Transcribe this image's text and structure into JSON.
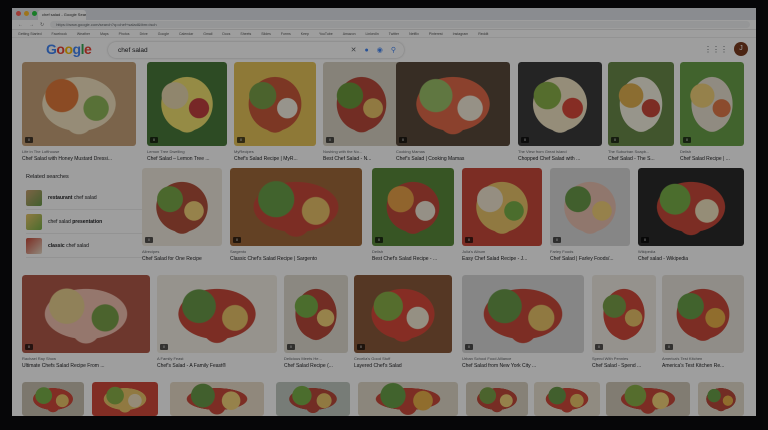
{
  "browser": {
    "tab_title": "chef salad - Google Search",
    "url": "https://www.google.com/search?q=chef+salad&tbm=isch",
    "bookmarks": [
      "Getting Started",
      "Facebook",
      "Weather",
      "Maps",
      "Photos",
      "Drive",
      "Google",
      "Calendar",
      "Gmail",
      "Docs",
      "Sheets",
      "Slides",
      "Forms",
      "Keep",
      "YouTube",
      "Amazon",
      "LinkedIn",
      "Twitter",
      "Netflix",
      "Pinterest",
      "Instagram",
      "Reddit"
    ]
  },
  "google": {
    "logo": "Google",
    "query": "chef salad",
    "avatar": "J"
  },
  "related": {
    "title": "Related searches",
    "items": [
      {
        "bold": "restaurant",
        "rest": " chef salad"
      },
      {
        "bold": "",
        "rest": "chef salad ",
        "bold2": "presentation"
      },
      {
        "bold": "classic",
        "rest": " chef salad"
      }
    ]
  },
  "results": [
    {
      "source": "Life in The Lofthouse",
      "title": "Chef Salad with Honey Mustard Dressi...",
      "colors": [
        "#c7a27a",
        "#e07a3a",
        "#8fb65a",
        "#f2e3c1"
      ]
    },
    {
      "source": "Lemon Tree Dwelling",
      "title": "Chef Salad – Lemon Tree ...",
      "colors": [
        "#4a7a3a",
        "#e8d8b0",
        "#c04040",
        "#f0e070"
      ]
    },
    {
      "source": "MyRecipes",
      "title": "Chef's Salad Recipe | MyR...",
      "colors": [
        "#e6c45a",
        "#7aa04a",
        "#f4efe2",
        "#c85a3a"
      ]
    },
    {
      "source": "Noshing with the No...",
      "title": "Best Chef Salad - N...",
      "colors": [
        "#d8d2c4",
        "#6b9a3c",
        "#e9c36a",
        "#b84a3a"
      ]
    },
    {
      "source": "Cooking Mamas",
      "title": "Chef's Salad | Cooking Mamas",
      "colors": [
        "#5a4a3a",
        "#9bc06a",
        "#f2ead8",
        "#e06a4a"
      ]
    },
    {
      "source": "The View from Great Island",
      "title": "Chopped Chef Salad with ...",
      "colors": [
        "#3a3a3a",
        "#8ab04a",
        "#d84a3a",
        "#f0e4c4"
      ]
    },
    {
      "source": "The Suburban Soapb...",
      "title": "Chef Salad - The S...",
      "colors": [
        "#6a8a4a",
        "#e0b050",
        "#c84a3a",
        "#f4f0e0"
      ]
    },
    {
      "source": "Delish",
      "title": "Chef Salad Recipe | ...",
      "colors": [
        "#6aa04a",
        "#f0d07a",
        "#e07a4a",
        "#e8e0d0"
      ]
    },
    {
      "source": "Allrecipes",
      "title": "Chef Salad for One Recipe",
      "colors": [
        "#efe9de",
        "#7aa84a",
        "#f2d27a",
        "#b0503a"
      ]
    },
    {
      "source": "Sargento",
      "title": "Classic Chef's Salad Recipe | Sargento",
      "colors": [
        "#a06a3a",
        "#6aa04a",
        "#e8c26a",
        "#c84a3a"
      ]
    },
    {
      "source": "Delish",
      "title": "Best Chef's Salad Recipe - ...",
      "colors": [
        "#5a8a3a",
        "#e8a24a",
        "#f0e8d8",
        "#c04a3a"
      ]
    },
    {
      "source": "Julia's Album",
      "title": "Easy Chef Salad Recipe - J...",
      "colors": [
        "#c84a3a",
        "#f0e6d0",
        "#7ab04a",
        "#e8c46a"
      ]
    },
    {
      "source": "Farley Foods",
      "title": "Chef Salad | Farley Foods/...",
      "colors": [
        "#d8d8d8",
        "#6a9a4a",
        "#f2d07a",
        "#e8c0b0"
      ]
    },
    {
      "source": "Wikipedia",
      "title": "Chef salad - Wikipedia",
      "colors": [
        "#2a2a2a",
        "#7ab04a",
        "#f0e4c0",
        "#c84a3a"
      ]
    },
    {
      "source": "Rachael Ray Show",
      "title": "Ultimate Chefs Salad Recipe From ...",
      "colors": [
        "#b05a4a",
        "#e8d090",
        "#7aa04a",
        "#f0c0b0"
      ]
    },
    {
      "source": "A Family Feast",
      "title": "Chef's Salad - A Family Feast®",
      "colors": [
        "#f2eee4",
        "#6a9a4a",
        "#e8c46a",
        "#c84a3a"
      ]
    },
    {
      "source": "Delicious Meets He...",
      "title": "Chef Salad Recipe (...",
      "colors": [
        "#e0dcd0",
        "#7ab04a",
        "#f2d27a",
        "#b84a3a"
      ]
    },
    {
      "source": "Cecelia's Good Stuff",
      "title": "Layered Chef's Salad",
      "colors": [
        "#8a5a3a",
        "#8ab04a",
        "#f0e8d4",
        "#d84a3a"
      ]
    },
    {
      "source": "Urban School Food Alliance",
      "title": "Chef Salad from New York City ...",
      "colors": [
        "#d8d8d8",
        "#6a9a4a",
        "#e8c46a",
        "#c84a3a"
      ]
    },
    {
      "source": "Spend With Pennies",
      "title": "Chef Salad - Spend ...",
      "colors": [
        "#f0ece4",
        "#7aa04a",
        "#e8c26a",
        "#d04a3a"
      ]
    },
    {
      "source": "America's Test Kitchen",
      "title": "America's Test Kitchen Re...",
      "colors": [
        "#e8e4dc",
        "#6aa04a",
        "#e8b04a",
        "#c84a3a"
      ]
    },
    {
      "source": "",
      "title": "",
      "colors": [
        "#c8c0b0",
        "#7ab04a",
        "#e8c46a",
        "#d04a3a"
      ]
    },
    {
      "source": "",
      "title": "",
      "colors": [
        "#d04a3a",
        "#8ab04a",
        "#f0e0c0",
        "#e8c46a"
      ]
    },
    {
      "source": "",
      "title": "",
      "colors": [
        "#e8dcc8",
        "#6a9a4a",
        "#f2d27a",
        "#c84a3a"
      ]
    },
    {
      "source": "",
      "title": "",
      "colors": [
        "#c0c8c0",
        "#7ab04a",
        "#e8c46a",
        "#b84a3a"
      ]
    },
    {
      "source": "",
      "title": "",
      "colors": [
        "#e0d8c8",
        "#6aa04a",
        "#e8b04a",
        "#c84a3a"
      ]
    },
    {
      "source": "",
      "title": "",
      "colors": [
        "#d8d0c0",
        "#7aa04a",
        "#f0d07a",
        "#c04a3a"
      ]
    },
    {
      "source": "",
      "title": "",
      "colors": [
        "#e8e0d0",
        "#6a9a4a",
        "#e8c46a",
        "#d04a3a"
      ]
    },
    {
      "source": "",
      "title": "",
      "colors": [
        "#d0c8b8",
        "#8ab04a",
        "#f2d27a",
        "#c84a3a"
      ]
    },
    {
      "source": "",
      "title": "",
      "colors": [
        "#e4dccc",
        "#6aa04a",
        "#e8b04a",
        "#b84a3a"
      ]
    }
  ]
}
